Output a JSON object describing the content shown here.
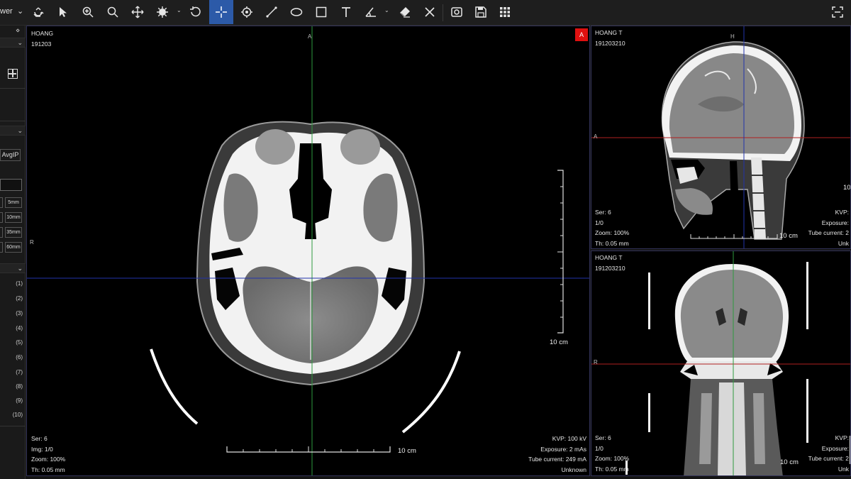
{
  "toolbar": {
    "layout_label": "wer",
    "tools": [
      {
        "name": "sync-icon"
      },
      {
        "name": "pointer-icon"
      },
      {
        "name": "zoom-in-icon"
      },
      {
        "name": "magnifier-icon"
      },
      {
        "name": "pan-icon"
      },
      {
        "name": "window-level-icon"
      },
      {
        "name": "reset-icon"
      },
      {
        "name": "crosshair-icon",
        "active": true
      },
      {
        "name": "target-icon"
      },
      {
        "name": "ruler-icon"
      },
      {
        "name": "ellipse-icon"
      },
      {
        "name": "rectangle-icon"
      },
      {
        "name": "text-icon"
      },
      {
        "name": "angle-icon"
      },
      {
        "name": "eraser-icon"
      },
      {
        "name": "clear-icon"
      },
      {
        "name": "screenshot-icon"
      },
      {
        "name": "save-icon"
      },
      {
        "name": "grid-layout-icon"
      },
      {
        "name": "fullscreen-icon"
      }
    ],
    "accent_color": "#2c5aa8"
  },
  "left_panel": {
    "avg_button": "AvgIP",
    "thickness_options": [
      "5mm",
      "10mm",
      "35mm",
      "60mm"
    ],
    "series": [
      "(1)",
      "(2)",
      "(3)",
      "(4)",
      "(5)",
      "(6)",
      "(7)",
      "(8)",
      "(9)",
      "(10)"
    ]
  },
  "viewports": {
    "axial": {
      "patient": "HOANG",
      "id": "191203",
      "marker": "A",
      "top_label": "A",
      "left_label": "R",
      "info_left": [
        "Ser: 6",
        "Img: 1/0",
        "Zoom: 100%",
        "Th: 0.05 mm"
      ],
      "info_right": [
        "KVP: 100 kV",
        "Exposure: 2 mAs",
        "Tube current: 249 mA",
        "Unknown"
      ],
      "scale_vertical": "10 cm",
      "scale_horizontal": "10 cm"
    },
    "sagittal": {
      "patient": "HOANG T",
      "id": "191203210",
      "top_label": "H",
      "left_label": "A",
      "info_left": [
        "Ser: 6",
        "1/0",
        "Zoom: 100%",
        "Th: 0.05 mm"
      ],
      "info_right": [
        "KVP:",
        "Exposure:",
        "Tube current: 2",
        "Unk"
      ],
      "scale_horizontal": "10 cm",
      "scale_edge": "10"
    },
    "coronal": {
      "patient": "HOANG T",
      "id": "191203210",
      "left_label": "R",
      "info_left": [
        "Ser: 6",
        "1/0",
        "Zoom: 100%",
        "Th: 0.05 mm"
      ],
      "info_right": [
        "KVP:",
        "Exposure:",
        "Tube current: 2",
        "Unk"
      ],
      "scale_horizontal": "10 cm"
    }
  },
  "crosshair_colors": {
    "vertical": "#2e9a3e",
    "horizontal_axial": "#2233aa",
    "horizontal_mpr": "#b02020",
    "sagittal_vertical": "#2233aa"
  }
}
